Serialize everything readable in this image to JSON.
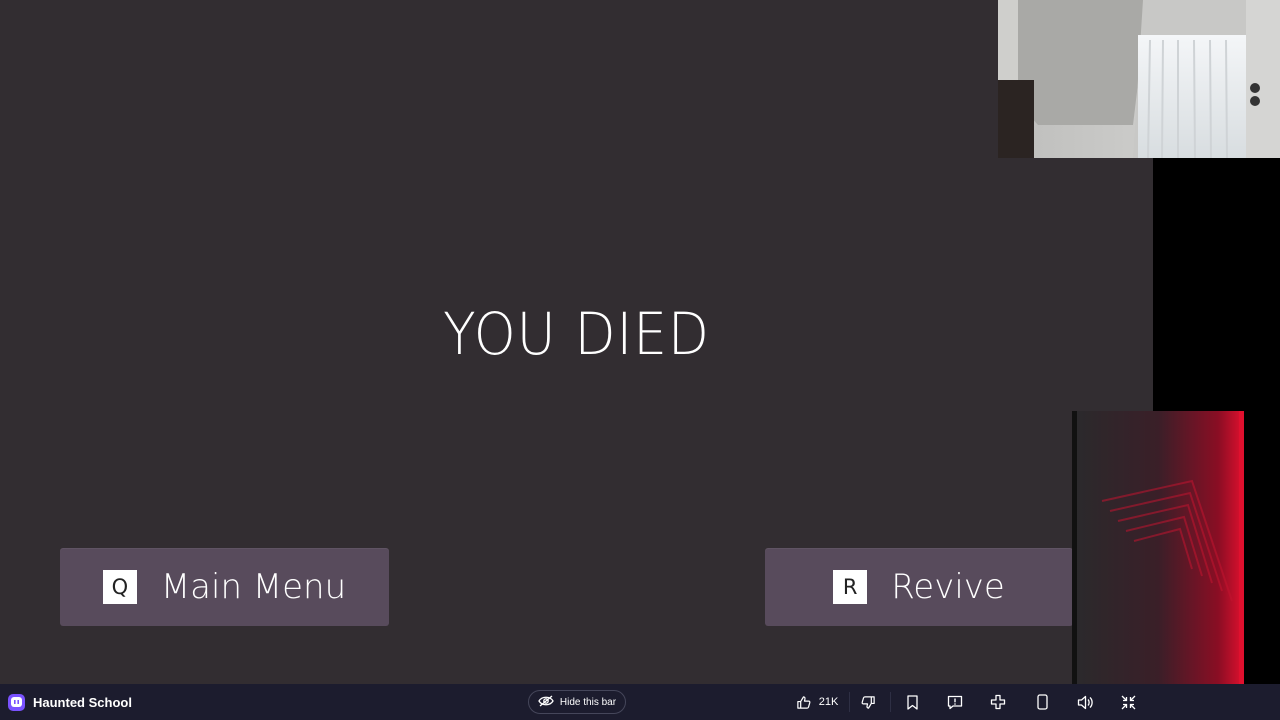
{
  "screen": {
    "title": "YOU DIED",
    "main_menu": {
      "key": "Q",
      "label": "Main Menu"
    },
    "revive": {
      "key": "R",
      "label": "Revive"
    }
  },
  "bottom_bar": {
    "game_name": "Haunted School",
    "hide_bar_label": "Hide this bar",
    "like_count": "21K",
    "icons": [
      "like-icon",
      "dislike-icon",
      "bookmark-icon",
      "report-icon",
      "controller-icon",
      "phone-icon",
      "volume-icon",
      "exit-fullscreen-icon"
    ]
  },
  "colors": {
    "game_bg": "#322d31",
    "button_bg": "#584b5c",
    "bar_bg": "#1c1c2e",
    "accent_red": "#e0102e",
    "brand_purple": "#7a52ff"
  }
}
